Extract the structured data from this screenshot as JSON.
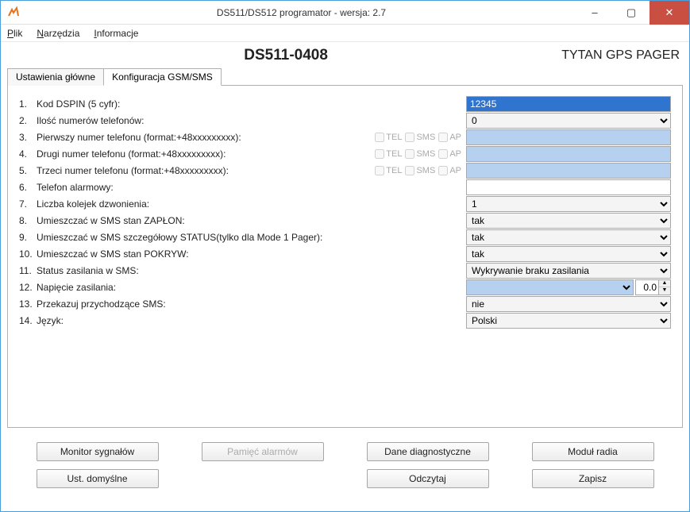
{
  "window": {
    "title": "DS511/DS512 programator - wersja:  2.7",
    "minimize": "–",
    "maximize": "▢",
    "close": "✕"
  },
  "menu": {
    "plik": "Plik",
    "narzedzia": "Narzędzia",
    "informacje": "Informacje"
  },
  "header": {
    "device": "DS511-0408",
    "brand": "TYTAN GPS PAGER"
  },
  "tabs": {
    "t1": "Ustawienia główne",
    "t2": "Konfiguracja GSM/SMS"
  },
  "opts": {
    "tel": "TEL",
    "sms": "SMS",
    "ap": "AP"
  },
  "rows": {
    "r1": {
      "n": "1.",
      "label": "Kod DSPIN (5 cyfr):",
      "value": "12345"
    },
    "r2": {
      "n": "2.",
      "label": "Ilość numerów telefonów:",
      "value": "0"
    },
    "r3": {
      "n": "3.",
      "label": "Pierwszy numer telefonu (format:+48xxxxxxxxx):",
      "value": ""
    },
    "r4": {
      "n": "4.",
      "label": "Drugi numer telefonu (format:+48xxxxxxxxx):",
      "value": ""
    },
    "r5": {
      "n": "5.",
      "label": "Trzeci numer telefonu (format:+48xxxxxxxxx):",
      "value": ""
    },
    "r6": {
      "n": "6.",
      "label": "Telefon alarmowy:",
      "value": ""
    },
    "r7": {
      "n": "7.",
      "label": "Liczba kolejek dzwonienia:",
      "value": "1"
    },
    "r8": {
      "n": "8.",
      "label": "Umieszczać w SMS stan ZAPŁON:",
      "value": "tak"
    },
    "r9": {
      "n": "9.",
      "label": "Umieszczać w SMS szczegółowy STATUS(tylko dla Mode 1 Pager):",
      "value": "tak"
    },
    "r10": {
      "n": "10.",
      "label": "Umieszczać w SMS stan POKRYW:",
      "value": "tak"
    },
    "r11": {
      "n": "11.",
      "label": "Status zasilania w SMS:",
      "value": "Wykrywanie braku zasilania"
    },
    "r12": {
      "n": "12.",
      "label": "Napięcie zasilania:",
      "value": "",
      "spin": "0.0"
    },
    "r13": {
      "n": "13.",
      "label": "Przekazuj przychodzące SMS:",
      "value": "nie"
    },
    "r14": {
      "n": "14.",
      "label": "Język:",
      "value": "Polski"
    }
  },
  "buttons": {
    "monitor": "Monitor sygnałów",
    "pamiec": "Pamięć alarmów",
    "diag": "Dane diagnostyczne",
    "radio": "Moduł radia",
    "domyslne": "Ust. domyślne",
    "odczytaj": "Odczytaj",
    "zapisz": "Zapisz"
  }
}
